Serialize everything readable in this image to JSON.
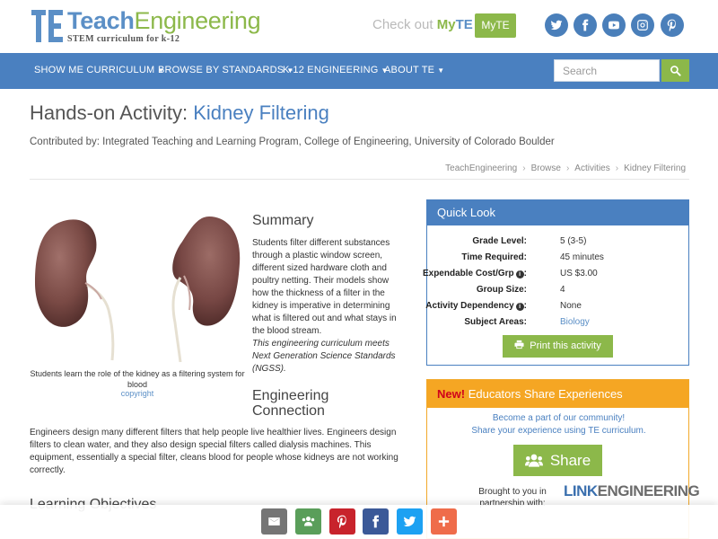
{
  "brand": {
    "name_teach": "Teach",
    "name_eng": "Engineering",
    "tagline": "STEM curriculum for k-12",
    "colors": {
      "blue": "#4a80c0",
      "green": "#8cb84a",
      "orange": "#f5a623"
    }
  },
  "header": {
    "checkout_text": "Check out",
    "myte_my": "My",
    "myte_te": "TE",
    "myte_button": "MyTE",
    "social": [
      "twitter-icon",
      "facebook-icon",
      "youtube-icon",
      "instagram-icon",
      "pinterest-icon"
    ]
  },
  "nav": {
    "items": [
      {
        "label": "SHOW ME CURRICULUM"
      },
      {
        "label": "BROWSE BY STANDARDS"
      },
      {
        "label": "K-12 ENGINEERING"
      },
      {
        "label": "ABOUT TE"
      }
    ],
    "search_placeholder": "Search"
  },
  "page": {
    "title_prefix": "Hands-on Activity:",
    "title_name": "Kidney Filtering",
    "contributed": "Contributed by: Integrated Teaching and Learning Program, College of Engineering, University of Colorado Boulder",
    "breadcrumbs": [
      "TeachEngineering",
      "Browse",
      "Activities",
      "Kidney Filtering"
    ]
  },
  "image": {
    "caption": "Students learn the role of the kidney as a filtering system for blood",
    "copyright": "copyright"
  },
  "summary": {
    "heading": "Summary",
    "text": "Students filter different substances through a plastic window screen, different sized hardware cloth and poultry netting. Their models show how the thickness of a filter in the kidney is imperative in determining what is filtered out and what stays in the blood stream.",
    "ngss": "This engineering curriculum meets Next Generation Science Standards (NGSS)."
  },
  "engineering": {
    "heading_1": "Engineering",
    "heading_2": "Connection",
    "text": "Engineers design many different filters that help people live healthier lives. Engineers design filters to clean water, and they also design special filters called dialysis machines. This equipment, essentially a special filter, cleans blood for people whose kidneys are not working correctly."
  },
  "learning": {
    "heading": "Learning Objectives"
  },
  "quick_look": {
    "heading": "Quick Look",
    "rows": [
      {
        "label": "Grade Level:",
        "value": "5 (3-5)"
      },
      {
        "label": "Time Required:",
        "value": "45 minutes"
      },
      {
        "label": "Expendable Cost/Grp",
        "value": "US $3.00"
      },
      {
        "label": "Group Size:",
        "value": "4"
      },
      {
        "label": "Activity Dependency",
        "value": "None"
      },
      {
        "label": "Subject Areas:",
        "value": "Biology"
      }
    ],
    "print_label": "Print this activity"
  },
  "educators": {
    "new": "New!",
    "heading": "Educators Share Experiences",
    "line1": "Become a part of our community!",
    "line2": "Share your experience using TE curriculum.",
    "share_label": "Share",
    "brought_by": "Brought to you in partnership with:",
    "partner_link": "LINK",
    "partner_eng": "ENGINEERING"
  },
  "share_bar": {
    "buttons": [
      {
        "icon": "email-icon",
        "color": "#757575"
      },
      {
        "icon": "group-icon",
        "color": "#5a9e5a"
      },
      {
        "icon": "pinterest-icon",
        "color": "#c8232c"
      },
      {
        "icon": "facebook-icon",
        "color": "#3b5998"
      },
      {
        "icon": "twitter-icon",
        "color": "#1da1f2"
      },
      {
        "icon": "plus-icon",
        "color": "#ef6c4a"
      }
    ]
  }
}
